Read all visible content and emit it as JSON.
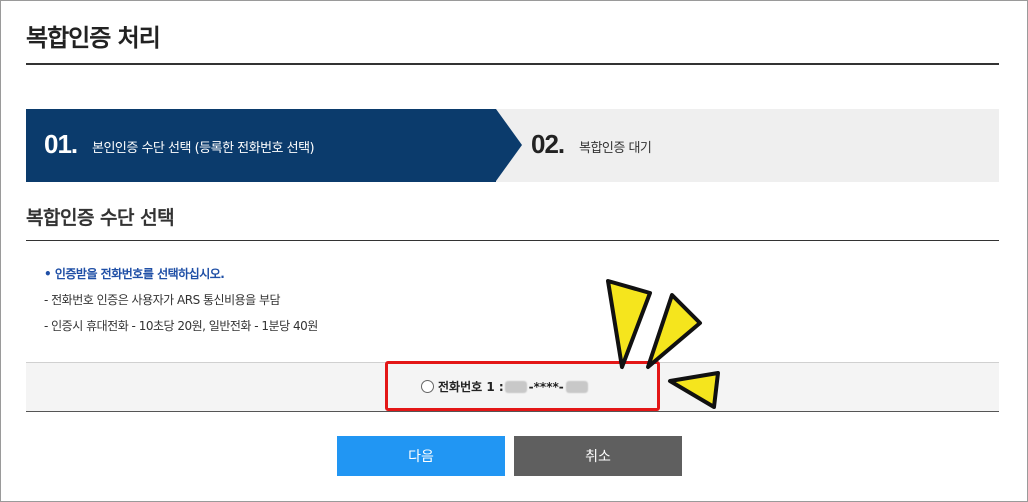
{
  "page": {
    "title": "복합인증 처리"
  },
  "steps": [
    {
      "number": "01.",
      "label": "본인인증 수단 선택 (등록한 전화번호 선택)",
      "active": true
    },
    {
      "number": "02.",
      "label": "복합인증 대기",
      "active": false
    }
  ],
  "section": {
    "title": "복합인증 수단 선택"
  },
  "notes": {
    "primary": "• 인증받을 전화번호를 선택하십시오.",
    "items": [
      "- 전화번호 인증은 사용자가 ARS 통신비용을 부담",
      "- 인증시 휴대전화 - 10초당 20원, 일반전화 - 1분당 40원"
    ]
  },
  "phone_option": {
    "label": "전화번호 1 :",
    "masked_middle": "-****-"
  },
  "buttons": {
    "next": "다음",
    "cancel": "취소"
  },
  "colors": {
    "step_active": "#0b3b6c",
    "next_button": "#2196f3",
    "cancel_button": "#5f5f5f",
    "highlight": "#e31616",
    "primary_note": "#1f4fa6"
  }
}
